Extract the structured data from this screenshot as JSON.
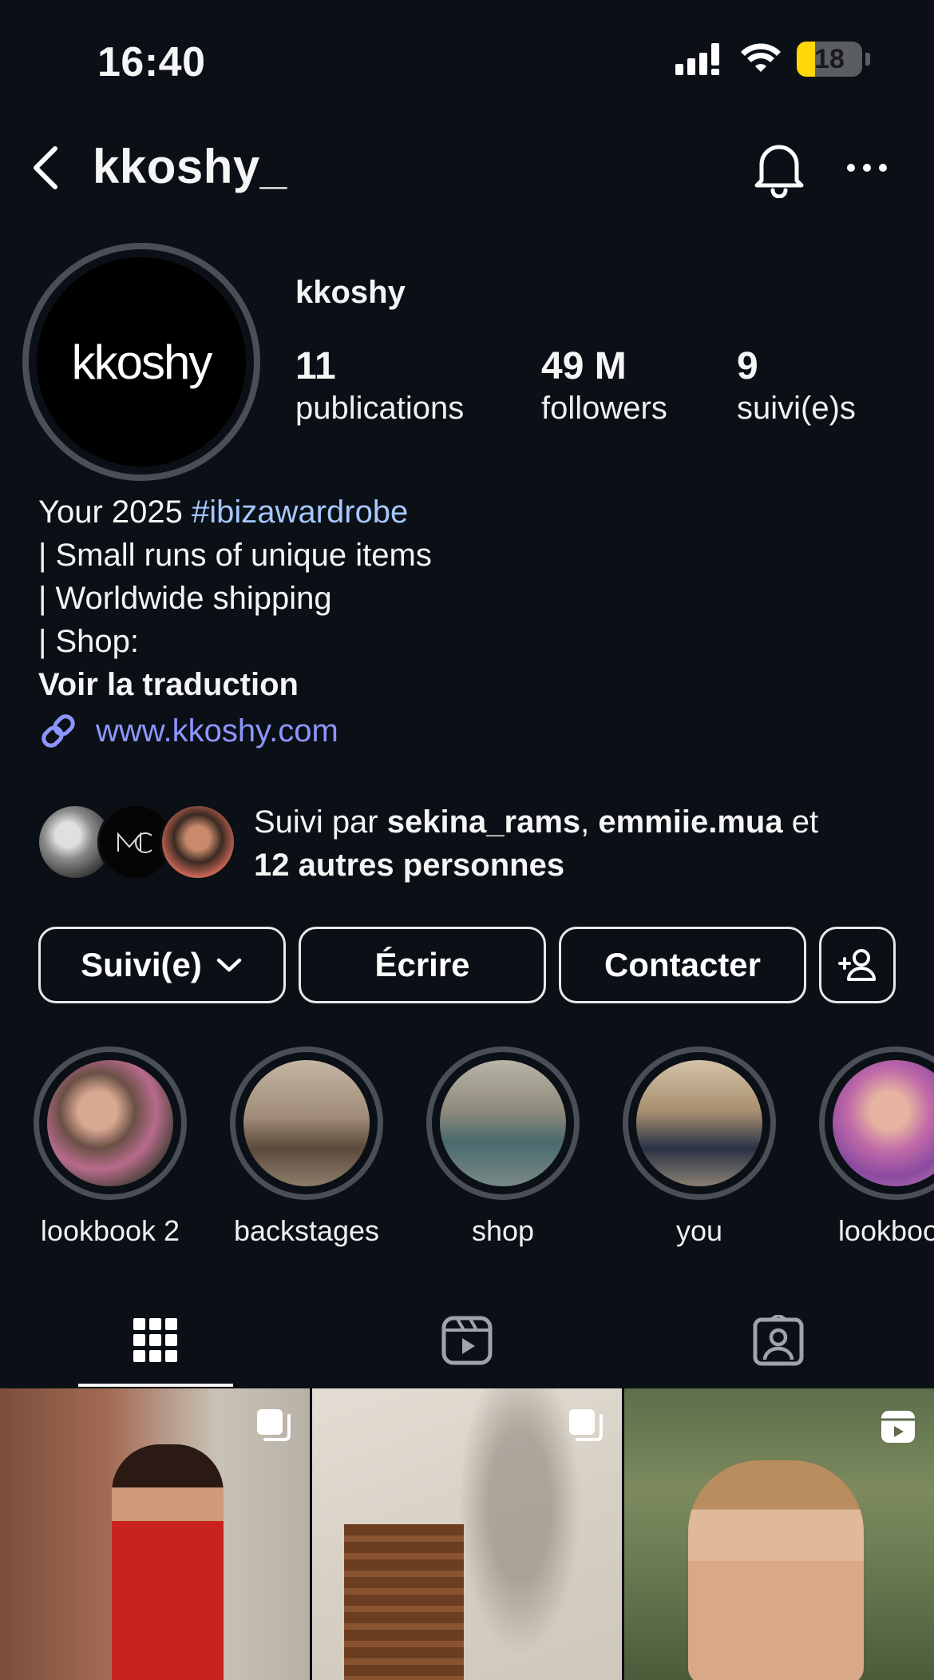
{
  "status_bar": {
    "time": "16:40",
    "battery": "18",
    "battery_level": 0.18,
    "battery_color": "#ffd60a"
  },
  "header": {
    "username": "kkoshy_"
  },
  "profile": {
    "avatar_logo": "kkoshy",
    "name": "kkoshy",
    "stats": [
      {
        "value": "11",
        "label": "publications"
      },
      {
        "value": "49 M",
        "label": "followers"
      },
      {
        "value": "9",
        "label": "suivi(e)s"
      }
    ]
  },
  "bio": {
    "line1_prefix": "Your 2025 ",
    "hashtag": "#ibizawardrobe",
    "line2": "| Small runs of unique items",
    "line3": "| Worldwide shipping",
    "line4": "| Shop:",
    "translate": "Voir la traduction",
    "link": "www.kkoshy.com"
  },
  "followed_by": {
    "prefix": "Suivi par ",
    "user1": "sekina_rams",
    "sep": ", ",
    "user2": "emmiie.mua",
    "and": " et",
    "others": "12 autres personnes"
  },
  "actions": {
    "following": "Suivi(e)",
    "message": "Écrire",
    "contact": "Contacter"
  },
  "highlights": [
    {
      "label": "lookbook 2"
    },
    {
      "label": "backstages"
    },
    {
      "label": "shop"
    },
    {
      "label": "you"
    },
    {
      "label": "lookbook"
    }
  ],
  "colors": {
    "background": "#0b1016",
    "link": "#8e95ff",
    "hashtag": "#a5c8ff",
    "ring": "#4a4f57"
  }
}
